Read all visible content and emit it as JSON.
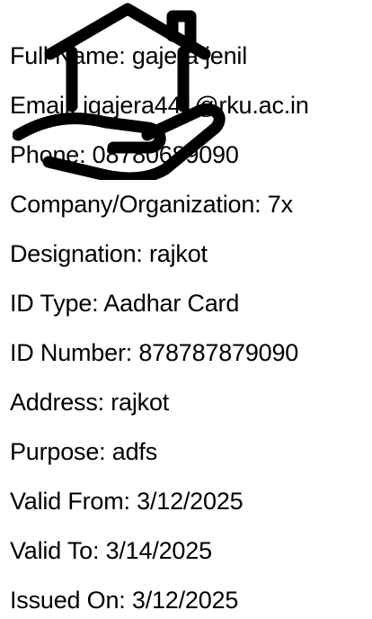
{
  "watermark_icon": "house-in-hand-icon",
  "details": [
    {
      "text": "Full Name: gajera jenil"
    },
    {
      "text": "Email: jgajera441@rku.ac.in"
    },
    {
      "text": "Phone: 08780689090"
    },
    {
      "text": "Company/Organization: 7x"
    },
    {
      "text": "Designation: rajkot"
    },
    {
      "text": "ID Type: Aadhar Card"
    },
    {
      "text": "ID Number: 878787879090"
    },
    {
      "text": "Address: rajkot"
    },
    {
      "text": "Purpose: adfs"
    },
    {
      "text": "Valid From: 3/12/2025"
    },
    {
      "text": "Valid To: 3/14/2025"
    },
    {
      "text": "Issued On: 3/12/2025"
    }
  ]
}
